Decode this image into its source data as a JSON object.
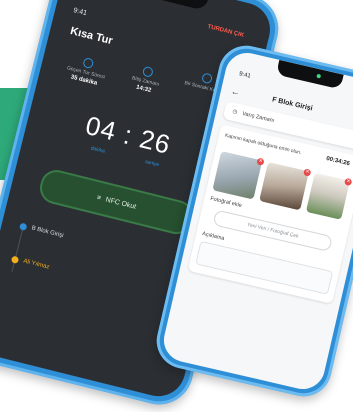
{
  "colors": {
    "band": "#2eaa7a",
    "accent_blue": "#2f8fd6",
    "dark_screen": "#2b2f33",
    "danger": "#ff5a4e",
    "warning": "#f2b01e"
  },
  "patrol_screen": {
    "status_time": "9:41",
    "title": "Kısa Tur",
    "exit_label": "TURDAN ÇIK",
    "stats": [
      {
        "label": "Geçen Tur Süresi",
        "value": "35 dakika"
      },
      {
        "label": "Bitiş Zamanı",
        "value": "14:32"
      },
      {
        "label": "Bir Sonraki Kontrol",
        "value": ""
      }
    ],
    "countdown": {
      "minutes": "04",
      "seconds": "26",
      "minutes_label": "dakika",
      "seconds_label": "saniye"
    },
    "nfc_button": "NFC Okut",
    "checkpoint": "B Blok Girişi",
    "user": "Ali Yılmaz"
  },
  "gate_screen": {
    "status_time": "9:41",
    "title": "F Blok Girişi",
    "visit_time_label": "Varış Zamanı",
    "door_check_label": "Kapının kapalı olduğuna emin olun.",
    "timer": "00:34:26",
    "photo_label": "Fotoğraf ekle",
    "photo_button": "Yeni Veri / Fotoğraf Çek",
    "note_label": "Açıklama"
  }
}
